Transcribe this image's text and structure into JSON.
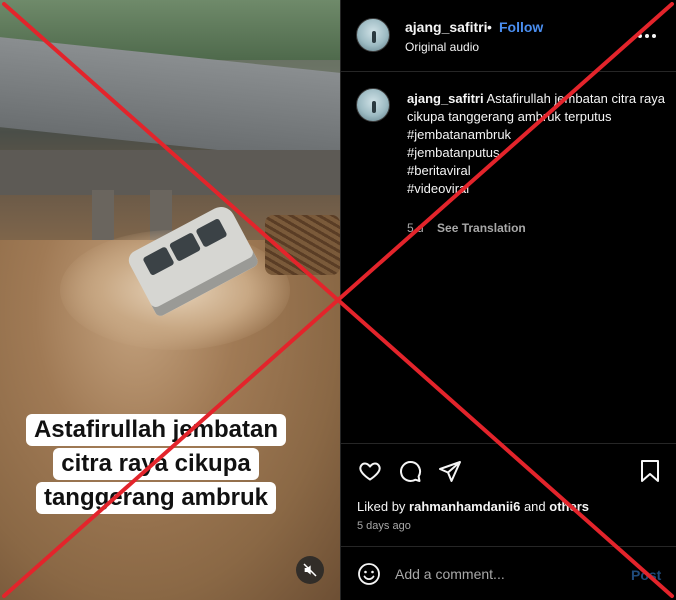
{
  "media": {
    "caption_lines": [
      "Astafirullah jembatan",
      "citra raya cikupa",
      "tanggerang ambruk"
    ],
    "mute_icon": "speaker-muted-icon"
  },
  "header": {
    "username": "ajang_safitri",
    "separator": "•",
    "follow_label": "Follow",
    "audio_label": "Original audio",
    "more_icon": "more-options-icon"
  },
  "post": {
    "username": "ajang_safitri",
    "caption": "Astafirullah jembatan citra raya cikupa tanggerang ambruk terputus",
    "hashtags": [
      "#jembatanambruk",
      "#jembatanputus",
      "#beritaviral",
      "#videoviral"
    ],
    "age": "5 d",
    "translation_label": "See Translation"
  },
  "actions": {
    "like_icon": "heart-icon",
    "comment_icon": "comment-icon",
    "share_icon": "share-icon",
    "save_icon": "bookmark-icon"
  },
  "likes": {
    "prefix": "Liked by",
    "user": "rahmanhamdanii6",
    "joiner": "and",
    "others": "others"
  },
  "timestamp": "5 days ago",
  "comment_box": {
    "placeholder": "Add a comment...",
    "post_label": "Post",
    "emoji_icon": "emoji-icon"
  },
  "overlay": {
    "color": "#e3242b",
    "mark": "fact-check-x"
  }
}
